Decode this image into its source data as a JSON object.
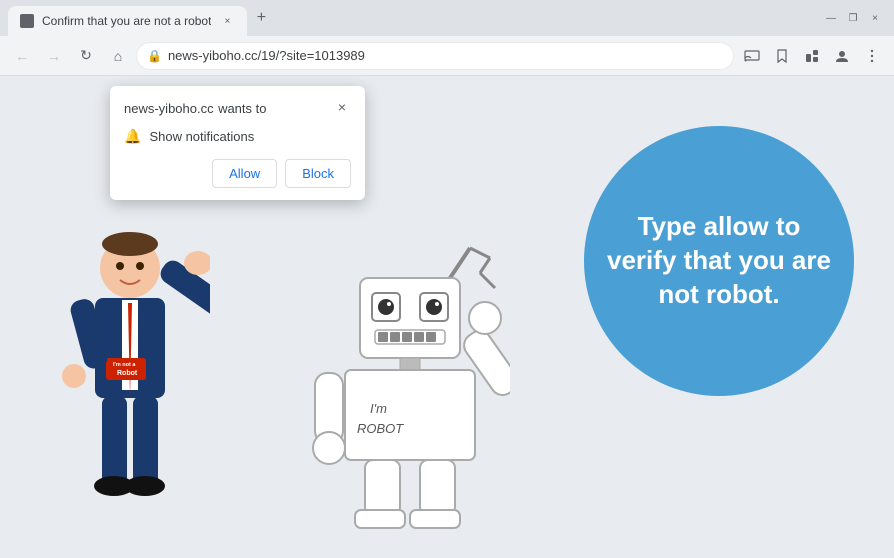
{
  "browser": {
    "title_bar": {
      "tab_title": "Confirm that you are not a robot",
      "close_icon": "×",
      "new_tab_icon": "+",
      "window_minimize": "—",
      "window_restore": "❐",
      "window_close": "×"
    },
    "nav_bar": {
      "back_btn": "←",
      "forward_btn": "→",
      "reload_btn": "↻",
      "home_btn": "⌂",
      "url": "news-yiboho.cc/19/?site=1013989",
      "lock_icon": "🔒",
      "star_icon": "☆",
      "extensions_icon": "🧩",
      "profile_icon": "👤",
      "menu_icon": "⋮",
      "cast_icon": "⬛"
    }
  },
  "notification_popup": {
    "site_name": "news-yiboho.cc",
    "wants_to_text": "wants to",
    "permission_label": "Show notifications",
    "allow_button": "Allow",
    "block_button": "Block",
    "close_icon": "×"
  },
  "page_content": {
    "circle_text": "Type allow to verify that you are not robot.",
    "background_color": "#e8ecf0",
    "circle_color": "#4a9fd4"
  }
}
